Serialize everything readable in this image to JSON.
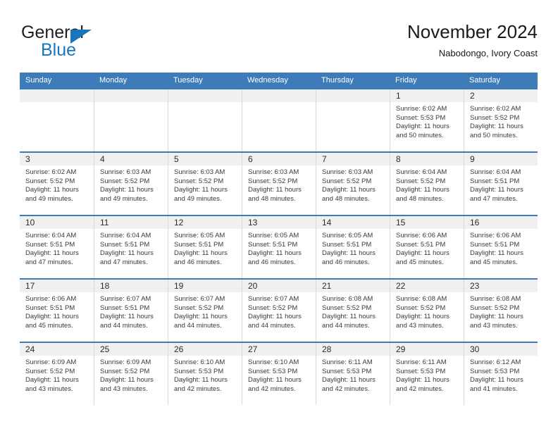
{
  "brand": {
    "name_part1": "General",
    "name_part2": "Blue",
    "primary_color": "#1b75bb",
    "triangle_icon": "triangle-icon"
  },
  "header": {
    "title": "November 2024",
    "location": "Nabodongo, Ivory Coast"
  },
  "calendar": {
    "header_color": "#3d7cb8",
    "daynum_band_color": "#f0f0f0",
    "weekday_headers": [
      "Sunday",
      "Monday",
      "Tuesday",
      "Wednesday",
      "Thursday",
      "Friday",
      "Saturday"
    ],
    "weeks": [
      [
        {
          "day": "",
          "sunrise": "",
          "sunset": "",
          "daylight_line1": "",
          "daylight_line2": ""
        },
        {
          "day": "",
          "sunrise": "",
          "sunset": "",
          "daylight_line1": "",
          "daylight_line2": ""
        },
        {
          "day": "",
          "sunrise": "",
          "sunset": "",
          "daylight_line1": "",
          "daylight_line2": ""
        },
        {
          "day": "",
          "sunrise": "",
          "sunset": "",
          "daylight_line1": "",
          "daylight_line2": ""
        },
        {
          "day": "",
          "sunrise": "",
          "sunset": "",
          "daylight_line1": "",
          "daylight_line2": ""
        },
        {
          "day": "1",
          "sunrise": "Sunrise: 6:02 AM",
          "sunset": "Sunset: 5:53 PM",
          "daylight_line1": "Daylight: 11 hours",
          "daylight_line2": "and 50 minutes."
        },
        {
          "day": "2",
          "sunrise": "Sunrise: 6:02 AM",
          "sunset": "Sunset: 5:52 PM",
          "daylight_line1": "Daylight: 11 hours",
          "daylight_line2": "and 50 minutes."
        }
      ],
      [
        {
          "day": "3",
          "sunrise": "Sunrise: 6:02 AM",
          "sunset": "Sunset: 5:52 PM",
          "daylight_line1": "Daylight: 11 hours",
          "daylight_line2": "and 49 minutes."
        },
        {
          "day": "4",
          "sunrise": "Sunrise: 6:03 AM",
          "sunset": "Sunset: 5:52 PM",
          "daylight_line1": "Daylight: 11 hours",
          "daylight_line2": "and 49 minutes."
        },
        {
          "day": "5",
          "sunrise": "Sunrise: 6:03 AM",
          "sunset": "Sunset: 5:52 PM",
          "daylight_line1": "Daylight: 11 hours",
          "daylight_line2": "and 49 minutes."
        },
        {
          "day": "6",
          "sunrise": "Sunrise: 6:03 AM",
          "sunset": "Sunset: 5:52 PM",
          "daylight_line1": "Daylight: 11 hours",
          "daylight_line2": "and 48 minutes."
        },
        {
          "day": "7",
          "sunrise": "Sunrise: 6:03 AM",
          "sunset": "Sunset: 5:52 PM",
          "daylight_line1": "Daylight: 11 hours",
          "daylight_line2": "and 48 minutes."
        },
        {
          "day": "8",
          "sunrise": "Sunrise: 6:04 AM",
          "sunset": "Sunset: 5:52 PM",
          "daylight_line1": "Daylight: 11 hours",
          "daylight_line2": "and 48 minutes."
        },
        {
          "day": "9",
          "sunrise": "Sunrise: 6:04 AM",
          "sunset": "Sunset: 5:51 PM",
          "daylight_line1": "Daylight: 11 hours",
          "daylight_line2": "and 47 minutes."
        }
      ],
      [
        {
          "day": "10",
          "sunrise": "Sunrise: 6:04 AM",
          "sunset": "Sunset: 5:51 PM",
          "daylight_line1": "Daylight: 11 hours",
          "daylight_line2": "and 47 minutes."
        },
        {
          "day": "11",
          "sunrise": "Sunrise: 6:04 AM",
          "sunset": "Sunset: 5:51 PM",
          "daylight_line1": "Daylight: 11 hours",
          "daylight_line2": "and 47 minutes."
        },
        {
          "day": "12",
          "sunrise": "Sunrise: 6:05 AM",
          "sunset": "Sunset: 5:51 PM",
          "daylight_line1": "Daylight: 11 hours",
          "daylight_line2": "and 46 minutes."
        },
        {
          "day": "13",
          "sunrise": "Sunrise: 6:05 AM",
          "sunset": "Sunset: 5:51 PM",
          "daylight_line1": "Daylight: 11 hours",
          "daylight_line2": "and 46 minutes."
        },
        {
          "day": "14",
          "sunrise": "Sunrise: 6:05 AM",
          "sunset": "Sunset: 5:51 PM",
          "daylight_line1": "Daylight: 11 hours",
          "daylight_line2": "and 46 minutes."
        },
        {
          "day": "15",
          "sunrise": "Sunrise: 6:06 AM",
          "sunset": "Sunset: 5:51 PM",
          "daylight_line1": "Daylight: 11 hours",
          "daylight_line2": "and 45 minutes."
        },
        {
          "day": "16",
          "sunrise": "Sunrise: 6:06 AM",
          "sunset": "Sunset: 5:51 PM",
          "daylight_line1": "Daylight: 11 hours",
          "daylight_line2": "and 45 minutes."
        }
      ],
      [
        {
          "day": "17",
          "sunrise": "Sunrise: 6:06 AM",
          "sunset": "Sunset: 5:51 PM",
          "daylight_line1": "Daylight: 11 hours",
          "daylight_line2": "and 45 minutes."
        },
        {
          "day": "18",
          "sunrise": "Sunrise: 6:07 AM",
          "sunset": "Sunset: 5:51 PM",
          "daylight_line1": "Daylight: 11 hours",
          "daylight_line2": "and 44 minutes."
        },
        {
          "day": "19",
          "sunrise": "Sunrise: 6:07 AM",
          "sunset": "Sunset: 5:52 PM",
          "daylight_line1": "Daylight: 11 hours",
          "daylight_line2": "and 44 minutes."
        },
        {
          "day": "20",
          "sunrise": "Sunrise: 6:07 AM",
          "sunset": "Sunset: 5:52 PM",
          "daylight_line1": "Daylight: 11 hours",
          "daylight_line2": "and 44 minutes."
        },
        {
          "day": "21",
          "sunrise": "Sunrise: 6:08 AM",
          "sunset": "Sunset: 5:52 PM",
          "daylight_line1": "Daylight: 11 hours",
          "daylight_line2": "and 44 minutes."
        },
        {
          "day": "22",
          "sunrise": "Sunrise: 6:08 AM",
          "sunset": "Sunset: 5:52 PM",
          "daylight_line1": "Daylight: 11 hours",
          "daylight_line2": "and 43 minutes."
        },
        {
          "day": "23",
          "sunrise": "Sunrise: 6:08 AM",
          "sunset": "Sunset: 5:52 PM",
          "daylight_line1": "Daylight: 11 hours",
          "daylight_line2": "and 43 minutes."
        }
      ],
      [
        {
          "day": "24",
          "sunrise": "Sunrise: 6:09 AM",
          "sunset": "Sunset: 5:52 PM",
          "daylight_line1": "Daylight: 11 hours",
          "daylight_line2": "and 43 minutes."
        },
        {
          "day": "25",
          "sunrise": "Sunrise: 6:09 AM",
          "sunset": "Sunset: 5:52 PM",
          "daylight_line1": "Daylight: 11 hours",
          "daylight_line2": "and 43 minutes."
        },
        {
          "day": "26",
          "sunrise": "Sunrise: 6:10 AM",
          "sunset": "Sunset: 5:53 PM",
          "daylight_line1": "Daylight: 11 hours",
          "daylight_line2": "and 42 minutes."
        },
        {
          "day": "27",
          "sunrise": "Sunrise: 6:10 AM",
          "sunset": "Sunset: 5:53 PM",
          "daylight_line1": "Daylight: 11 hours",
          "daylight_line2": "and 42 minutes."
        },
        {
          "day": "28",
          "sunrise": "Sunrise: 6:11 AM",
          "sunset": "Sunset: 5:53 PM",
          "daylight_line1": "Daylight: 11 hours",
          "daylight_line2": "and 42 minutes."
        },
        {
          "day": "29",
          "sunrise": "Sunrise: 6:11 AM",
          "sunset": "Sunset: 5:53 PM",
          "daylight_line1": "Daylight: 11 hours",
          "daylight_line2": "and 42 minutes."
        },
        {
          "day": "30",
          "sunrise": "Sunrise: 6:12 AM",
          "sunset": "Sunset: 5:53 PM",
          "daylight_line1": "Daylight: 11 hours",
          "daylight_line2": "and 41 minutes."
        }
      ]
    ]
  }
}
